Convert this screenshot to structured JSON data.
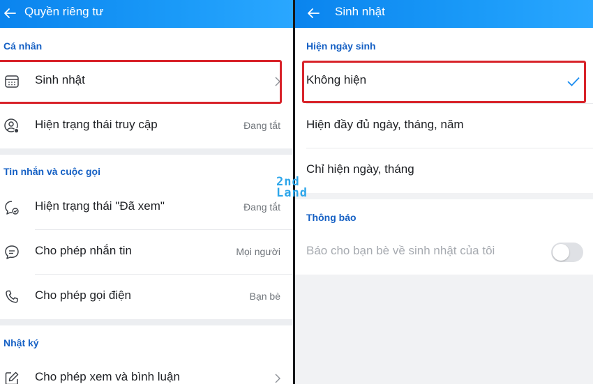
{
  "left": {
    "title": "Quyền riêng tư",
    "sections": [
      {
        "label": "Cá nhân",
        "rows": [
          {
            "label": "Sinh nhật",
            "value": "",
            "icon": "calendar-icon",
            "has_chevron": true
          },
          {
            "label": "Hiện trạng thái truy cập",
            "value": "Đang tắt",
            "icon": "user-status-icon"
          }
        ]
      },
      {
        "label": "Tin nhắn và cuộc gọi",
        "rows": [
          {
            "label": "Hiện trạng thái \"Đã xem\"",
            "value": "Đang tắt",
            "icon": "seen-chat-icon"
          },
          {
            "label": "Cho phép nhắn tin",
            "value": "Mọi người",
            "icon": "message-icon"
          },
          {
            "label": "Cho phép gọi điện",
            "value": "Bạn bè",
            "icon": "phone-icon"
          }
        ]
      },
      {
        "label": "Nhật ký",
        "rows": [
          {
            "label": "Cho phép xem và bình luận",
            "value": "",
            "icon": "edit-icon",
            "has_chevron": true
          }
        ]
      }
    ]
  },
  "right": {
    "title": "Sinh nhật",
    "section1": "Hiện ngày sinh",
    "options": [
      {
        "label": "Không hiện",
        "selected": true
      },
      {
        "label": "Hiện đầy đủ ngày, tháng, năm",
        "selected": false
      },
      {
        "label": "Chỉ hiện ngày, tháng",
        "selected": false
      }
    ],
    "section2": "Thông báo",
    "notify": {
      "label": "Báo cho bạn bè về sinh nhật của tôi",
      "enabled": false
    }
  },
  "watermark": {
    "line1": "2nd",
    "line2": "Land"
  },
  "colors": {
    "header": "#0a84ee",
    "accent": "#1560c4",
    "highlight": "#d8232a",
    "check": "#1a8cf0"
  }
}
